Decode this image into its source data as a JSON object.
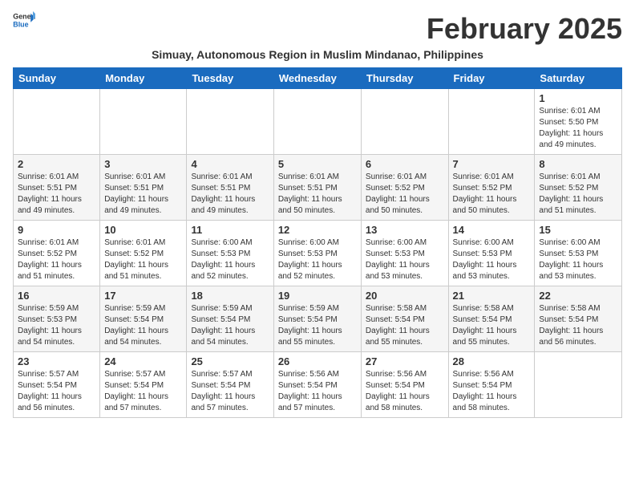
{
  "logo": {
    "general": "General",
    "blue": "Blue"
  },
  "title": "February 2025",
  "subtitle": "Simuay, Autonomous Region in Muslim Mindanao, Philippines",
  "days_of_week": [
    "Sunday",
    "Monday",
    "Tuesday",
    "Wednesday",
    "Thursday",
    "Friday",
    "Saturday"
  ],
  "weeks": [
    {
      "days": [
        {
          "date": "",
          "info": ""
        },
        {
          "date": "",
          "info": ""
        },
        {
          "date": "",
          "info": ""
        },
        {
          "date": "",
          "info": ""
        },
        {
          "date": "",
          "info": ""
        },
        {
          "date": "",
          "info": ""
        },
        {
          "date": "1",
          "info": "Sunrise: 6:01 AM\nSunset: 5:50 PM\nDaylight: 11 hours and 49 minutes."
        }
      ]
    },
    {
      "days": [
        {
          "date": "2",
          "info": "Sunrise: 6:01 AM\nSunset: 5:51 PM\nDaylight: 11 hours and 49 minutes."
        },
        {
          "date": "3",
          "info": "Sunrise: 6:01 AM\nSunset: 5:51 PM\nDaylight: 11 hours and 49 minutes."
        },
        {
          "date": "4",
          "info": "Sunrise: 6:01 AM\nSunset: 5:51 PM\nDaylight: 11 hours and 49 minutes."
        },
        {
          "date": "5",
          "info": "Sunrise: 6:01 AM\nSunset: 5:51 PM\nDaylight: 11 hours and 50 minutes."
        },
        {
          "date": "6",
          "info": "Sunrise: 6:01 AM\nSunset: 5:52 PM\nDaylight: 11 hours and 50 minutes."
        },
        {
          "date": "7",
          "info": "Sunrise: 6:01 AM\nSunset: 5:52 PM\nDaylight: 11 hours and 50 minutes."
        },
        {
          "date": "8",
          "info": "Sunrise: 6:01 AM\nSunset: 5:52 PM\nDaylight: 11 hours and 51 minutes."
        }
      ]
    },
    {
      "days": [
        {
          "date": "9",
          "info": "Sunrise: 6:01 AM\nSunset: 5:52 PM\nDaylight: 11 hours and 51 minutes."
        },
        {
          "date": "10",
          "info": "Sunrise: 6:01 AM\nSunset: 5:52 PM\nDaylight: 11 hours and 51 minutes."
        },
        {
          "date": "11",
          "info": "Sunrise: 6:00 AM\nSunset: 5:53 PM\nDaylight: 11 hours and 52 minutes."
        },
        {
          "date": "12",
          "info": "Sunrise: 6:00 AM\nSunset: 5:53 PM\nDaylight: 11 hours and 52 minutes."
        },
        {
          "date": "13",
          "info": "Sunrise: 6:00 AM\nSunset: 5:53 PM\nDaylight: 11 hours and 53 minutes."
        },
        {
          "date": "14",
          "info": "Sunrise: 6:00 AM\nSunset: 5:53 PM\nDaylight: 11 hours and 53 minutes."
        },
        {
          "date": "15",
          "info": "Sunrise: 6:00 AM\nSunset: 5:53 PM\nDaylight: 11 hours and 53 minutes."
        }
      ]
    },
    {
      "days": [
        {
          "date": "16",
          "info": "Sunrise: 5:59 AM\nSunset: 5:53 PM\nDaylight: 11 hours and 54 minutes."
        },
        {
          "date": "17",
          "info": "Sunrise: 5:59 AM\nSunset: 5:54 PM\nDaylight: 11 hours and 54 minutes."
        },
        {
          "date": "18",
          "info": "Sunrise: 5:59 AM\nSunset: 5:54 PM\nDaylight: 11 hours and 54 minutes."
        },
        {
          "date": "19",
          "info": "Sunrise: 5:59 AM\nSunset: 5:54 PM\nDaylight: 11 hours and 55 minutes."
        },
        {
          "date": "20",
          "info": "Sunrise: 5:58 AM\nSunset: 5:54 PM\nDaylight: 11 hours and 55 minutes."
        },
        {
          "date": "21",
          "info": "Sunrise: 5:58 AM\nSunset: 5:54 PM\nDaylight: 11 hours and 55 minutes."
        },
        {
          "date": "22",
          "info": "Sunrise: 5:58 AM\nSunset: 5:54 PM\nDaylight: 11 hours and 56 minutes."
        }
      ]
    },
    {
      "days": [
        {
          "date": "23",
          "info": "Sunrise: 5:57 AM\nSunset: 5:54 PM\nDaylight: 11 hours and 56 minutes."
        },
        {
          "date": "24",
          "info": "Sunrise: 5:57 AM\nSunset: 5:54 PM\nDaylight: 11 hours and 57 minutes."
        },
        {
          "date": "25",
          "info": "Sunrise: 5:57 AM\nSunset: 5:54 PM\nDaylight: 11 hours and 57 minutes."
        },
        {
          "date": "26",
          "info": "Sunrise: 5:56 AM\nSunset: 5:54 PM\nDaylight: 11 hours and 57 minutes."
        },
        {
          "date": "27",
          "info": "Sunrise: 5:56 AM\nSunset: 5:54 PM\nDaylight: 11 hours and 58 minutes."
        },
        {
          "date": "28",
          "info": "Sunrise: 5:56 AM\nSunset: 5:54 PM\nDaylight: 11 hours and 58 minutes."
        },
        {
          "date": "",
          "info": ""
        }
      ]
    }
  ]
}
